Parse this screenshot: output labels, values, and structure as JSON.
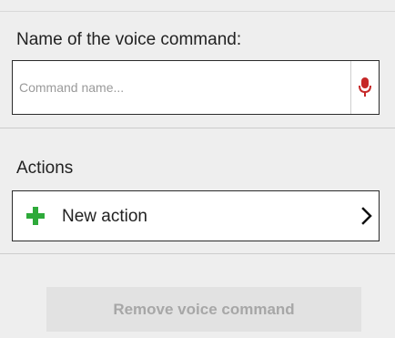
{
  "name_section": {
    "title": "Name of the voice command:",
    "input_value": "",
    "input_placeholder": "Command name...",
    "mic_icon": "microphone-icon",
    "mic_color": "#c62828"
  },
  "actions_section": {
    "title": "Actions",
    "new_action_label": "New action",
    "add_icon": "plus-icon",
    "add_icon_color": "#2eaa3a",
    "nav_icon": "chevron-right-icon"
  },
  "footer": {
    "remove_label": "Remove voice command",
    "remove_enabled": false
  }
}
